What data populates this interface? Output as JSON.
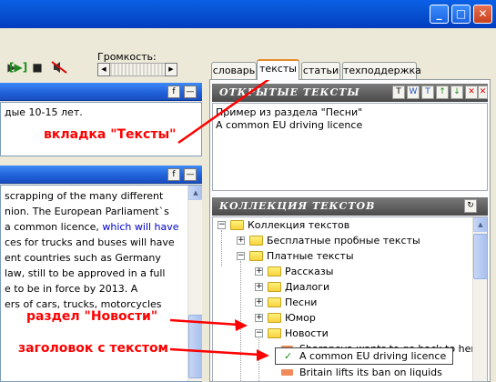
{
  "titlebar": {
    "buttons": [
      "_",
      "□",
      "✕"
    ]
  },
  "toolbar": {
    "volume_label": "Громкость:",
    "slider_left": "◀",
    "slider_right": "▶"
  },
  "left_top_pane": {
    "btn_f": "f",
    "btn_min": "—",
    "text": "дые 10-15 лет."
  },
  "left_bottom_pane": {
    "btn_f": "f",
    "btn_min": "—",
    "lines": [
      "scrapping of the many different",
      "nion. The European Parliament`s",
      "a common licence, ",
      "ces for trucks and buses will have",
      "ent countries such as Germany",
      " law, still to be approved in a full",
      "e to be in force by 2013. A",
      "ers of cars, trucks, motorcycles"
    ],
    "line3_link": "which will have"
  },
  "tabs": [
    "словарь",
    "тексты",
    "статьи",
    "техподдержка"
  ],
  "open_texts": {
    "title": "ОТКРЫТЫЕ ТЕКСТЫ",
    "icons": [
      "T",
      "W",
      "T",
      "↑",
      "↓",
      "✕",
      "✕"
    ],
    "items": [
      "Пример из раздела \"Песни\"",
      "A common EU driving licence"
    ]
  },
  "collection": {
    "title": "КОЛЛЕКЦИЯ ТЕКСТОВ",
    "refresh": "↻",
    "tree": [
      {
        "label": "Коллекция текстов",
        "level": 0,
        "exp": "−",
        "kind": "folder"
      },
      {
        "label": "Бесплатные пробные тексты",
        "level": 1,
        "exp": "+",
        "kind": "folder"
      },
      {
        "label": "Платные тексты",
        "level": 1,
        "exp": "−",
        "kind": "folder"
      },
      {
        "label": "Рассказы",
        "level": 2,
        "exp": "+",
        "kind": "folder"
      },
      {
        "label": "Диалоги",
        "level": 2,
        "exp": "+",
        "kind": "folder"
      },
      {
        "label": "Песни",
        "level": 2,
        "exp": "+",
        "kind": "folder"
      },
      {
        "label": "Юмор",
        "level": 2,
        "exp": "+",
        "kind": "folder"
      },
      {
        "label": "Новости",
        "level": 2,
        "exp": "−",
        "kind": "folder"
      },
      {
        "label": "Sharapova wants to go back to her roc",
        "level": 3,
        "exp": "",
        "kind": "doc"
      },
      {
        "label": "A common EU driving licence",
        "level": 3,
        "exp": "",
        "kind": "check"
      },
      {
        "label": "Britain lifts its ban on liquids",
        "level": 3,
        "exp": "",
        "kind": "doc"
      }
    ]
  },
  "annotations": {
    "tab_label": "вкладка \"Тексты\"",
    "news_label": "раздел \"Новости\"",
    "heading_label": "заголовок с текстом"
  },
  "colors": {
    "annotation": "#ff0000",
    "xp_blue": "#0a5fe8"
  }
}
